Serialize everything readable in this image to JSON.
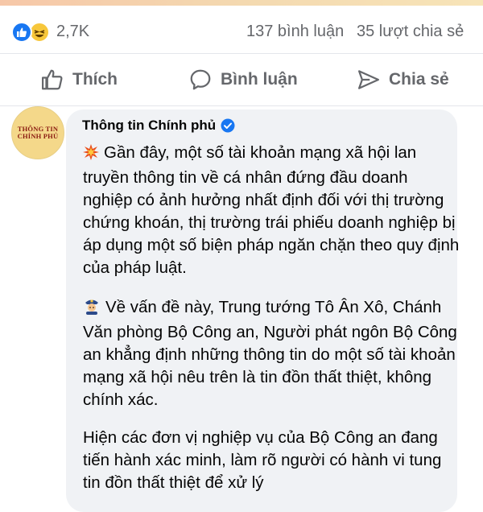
{
  "reactions": {
    "count": "2,7K",
    "comments": "137 bình luận",
    "shares": "35 lượt chia sẻ"
  },
  "actions": {
    "like": "Thích",
    "comment": "Bình luận",
    "share": "Chia sẻ"
  },
  "comment": {
    "avatar_line1": "THÔNG TIN",
    "avatar_line2": "CHÍNH PHỦ",
    "author": "Thông tin Chính phủ",
    "paragraphs": [
      "Gần đây, một số tài khoản mạng xã hội lan truyền thông tin về cá nhân đứng đầu doanh nghiệp có ảnh hưởng nhất định đối với thị trường chứng khoán, thị trường trái phiếu doanh nghiệp bị áp dụng một số biện pháp ngăn chặn theo quy định của pháp luật.",
      "Về vấn đề này, Trung tướng Tô Ân Xô, Chánh Văn phòng Bộ Công an, Người phát ngôn Bộ Công an khẳng định những thông tin do một số tài khoản mạng xã hội nêu trên là tin đồn thất thiệt, không chính xác.",
      "Hiện các đơn vị nghiệp vụ của Bộ Công an đang tiến hành xác minh, làm rõ người có hành vi tung tin đồn thất thiệt để xử lý"
    ]
  },
  "colors": {
    "like_blue": "#1877f2",
    "secondary_text": "#65676b",
    "bubble_bg": "#f0f2f5"
  },
  "icons": [
    "like-reaction-icon",
    "haha-reaction-icon",
    "thumbs-up-icon",
    "speech-bubble-icon",
    "share-arrow-icon",
    "verified-badge-icon",
    "collision-emoji-icon",
    "police-officer-emoji-icon"
  ]
}
